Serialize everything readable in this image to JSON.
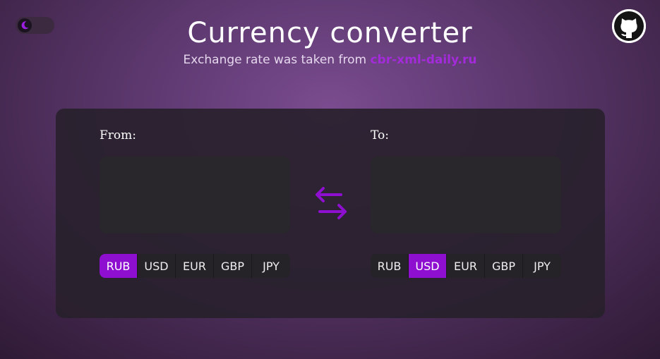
{
  "header": {
    "title": "Currency converter",
    "subtitle_prefix": "Exchange rate was taken from ",
    "source_link": "cbr-xml-daily.ru"
  },
  "icons": {
    "theme": "moon-icon",
    "github": "github-icon",
    "swap": "swap-arrows-icon"
  },
  "converter": {
    "from_label": "From:",
    "to_label": "To:",
    "from_value": "",
    "to_value": "",
    "from_currencies": [
      "RUB",
      "USD",
      "EUR",
      "GBP",
      "JPY"
    ],
    "to_currencies": [
      "RUB",
      "USD",
      "EUR",
      "GBP",
      "JPY"
    ],
    "from_selected": "RUB",
    "to_selected": "USD"
  },
  "colors": {
    "accent": "#8e0fd0",
    "link": "#a32bd9"
  }
}
